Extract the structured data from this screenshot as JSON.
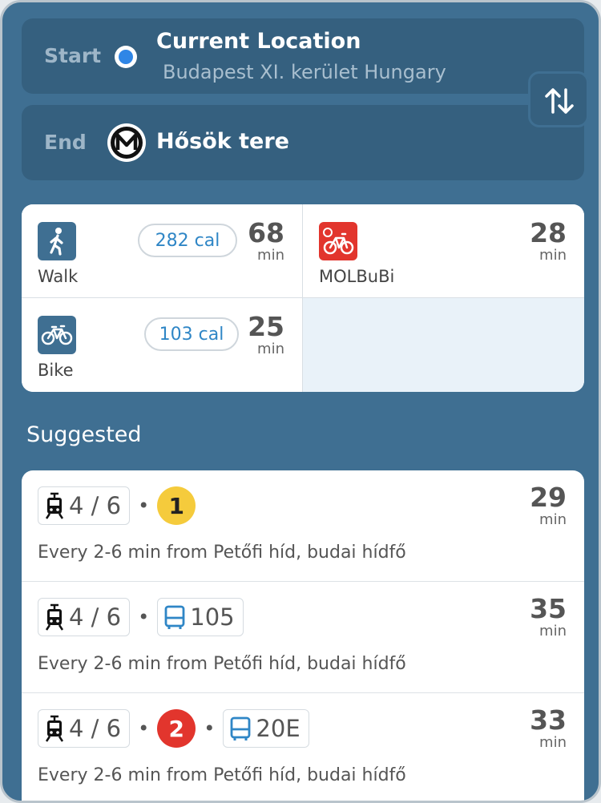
{
  "start": {
    "label": "Start",
    "title": "Current Location",
    "subtitle": "Budapest XI. kerület Hungary"
  },
  "end": {
    "label": "End",
    "title": "Hősök tere"
  },
  "modes": {
    "walk": {
      "name": "Walk",
      "calories": "282 cal",
      "minutes": "68",
      "unit": "min"
    },
    "bubi": {
      "name": "MOLBuBi",
      "minutes": "28",
      "unit": "min"
    },
    "bike": {
      "name": "Bike",
      "calories": "103 cal",
      "minutes": "25",
      "unit": "min"
    }
  },
  "suggested": {
    "title": "Suggested",
    "routes": [
      {
        "tram": "4 / 6",
        "second": "1",
        "minutes": "29",
        "unit": "min",
        "desc": "Every 2-6 min from Petőfi híd, budai hídfő"
      },
      {
        "tram": "4 / 6",
        "bus": "105",
        "minutes": "35",
        "unit": "min",
        "desc": "Every 2-6 min from Petőfi híd, budai hídfő"
      },
      {
        "tram": "4 / 6",
        "metro": "2",
        "bus": "20E",
        "minutes": "33",
        "unit": "min",
        "desc": "Every 2-6 min from Petőfi híd, budai hídfő"
      }
    ]
  },
  "colors": {
    "background": "#3f6f92",
    "field": "#35607f",
    "metro_line_1": "#f5cb3c",
    "metro_line_2": "#e2352d",
    "bus": "#2f86c6",
    "location_dot": "#2f86e6"
  }
}
